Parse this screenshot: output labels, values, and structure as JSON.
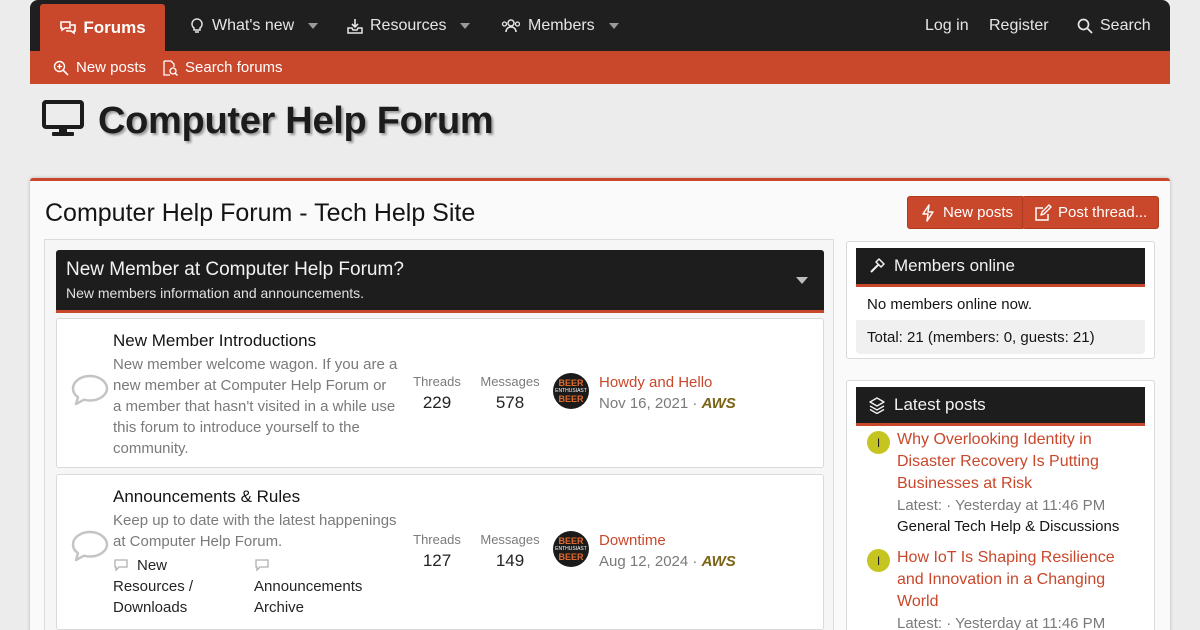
{
  "nav": {
    "tabs": [
      {
        "label": "Forums",
        "icon": "comments-icon"
      },
      {
        "label": "What's new",
        "icon": "lightbulb-icon"
      },
      {
        "label": "Resources",
        "icon": "download-icon"
      },
      {
        "label": "Members",
        "icon": "users-icon"
      }
    ],
    "login": "Log in",
    "register": "Register",
    "search": "Search"
  },
  "subnav": {
    "new_posts": "New posts",
    "search_forums": "Search forums"
  },
  "site": {
    "title": "Computer Help Forum",
    "icon": "monitor-icon"
  },
  "page": {
    "title": "Computer Help Forum - Tech Help Site",
    "new_posts_button": "New posts",
    "post_thread_button": "Post thread..."
  },
  "category": {
    "title": "New Member at Computer Help Forum?",
    "description": "New members information and announcements."
  },
  "nodes": [
    {
      "title": "New Member Introductions",
      "description": "New member welcome wagon. If you are a new member at Computer Help Forum or a member that hasn't visited in a while use this forum to introduce yourself to the community.",
      "threads_label": "Threads",
      "threads": "229",
      "messages_label": "Messages",
      "messages": "578",
      "last_title": "Howdy and Hello",
      "last_date": "Nov 16, 2021 ·",
      "last_user": "AWS"
    },
    {
      "title": "Announcements & Rules",
      "description": "Keep up to date with the latest happenings at Computer Help Forum.",
      "threads_label": "Threads",
      "threads": "127",
      "messages_label": "Messages",
      "messages": "149",
      "last_title": "Downtime",
      "last_date": "Aug 12, 2024 ·",
      "last_user": "AWS",
      "subforums": [
        "New Resources / Downloads",
        "Announcements Archive"
      ]
    }
  ],
  "avatar": {
    "top": "BEER",
    "middle": "ENTHUSIAST",
    "bottom": "BEER"
  },
  "members_online": {
    "title": "Members online",
    "status": "No members online now.",
    "total": "Total: 21 (members: 0, guests: 21)"
  },
  "latest_posts": {
    "title": "Latest posts",
    "items": [
      {
        "initial": "I",
        "title": "Why Overlooking Identity in Disaster Recovery Is Putting Businesses at Risk",
        "meta": "Latest: · Yesterday at 11:46 PM",
        "forum": "General Tech Help & Discussions"
      },
      {
        "initial": "I",
        "title": "How IoT Is Shaping Resilience and Innovation in a Changing World",
        "meta": "Latest: · Yesterday at 11:46 PM"
      }
    ]
  },
  "colors": {
    "accent": "#c9472b",
    "nav_bg": "#1f1f1f",
    "avatar_dot": "#c5c420"
  }
}
